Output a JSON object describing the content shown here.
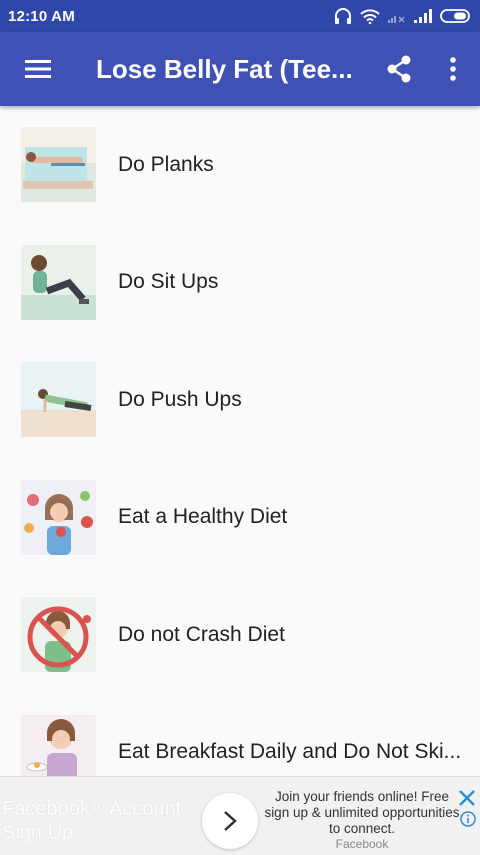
{
  "status_bar": {
    "time": "12:10 AM",
    "icons": [
      "headphones-icon",
      "wifi-icon",
      "no-signal-icon",
      "signal-icon",
      "battery-icon"
    ]
  },
  "app_bar": {
    "title": "Lose Belly Fat (Tee...",
    "icons": [
      "menu-icon",
      "share-icon",
      "more-vert-icon"
    ]
  },
  "items": [
    {
      "label": "Do Planks"
    },
    {
      "label": "Do Sit Ups"
    },
    {
      "label": "Do Push Ups"
    },
    {
      "label": "Eat a Healthy Diet"
    },
    {
      "label": "Do not Crash Diet"
    },
    {
      "label": "Eat Breakfast Daily and Do Not Ski..."
    }
  ],
  "ad": {
    "headline": "Facebook® Account Sign Up",
    "body": "Join your friends online! Free sign up & unlimited opportunities to connect.",
    "source": "Facebook"
  },
  "colors": {
    "status_bar": "#2f47a8",
    "app_bar": "#3f51b5",
    "background": "#fafafa",
    "ad_close": "#2d8fd6"
  }
}
